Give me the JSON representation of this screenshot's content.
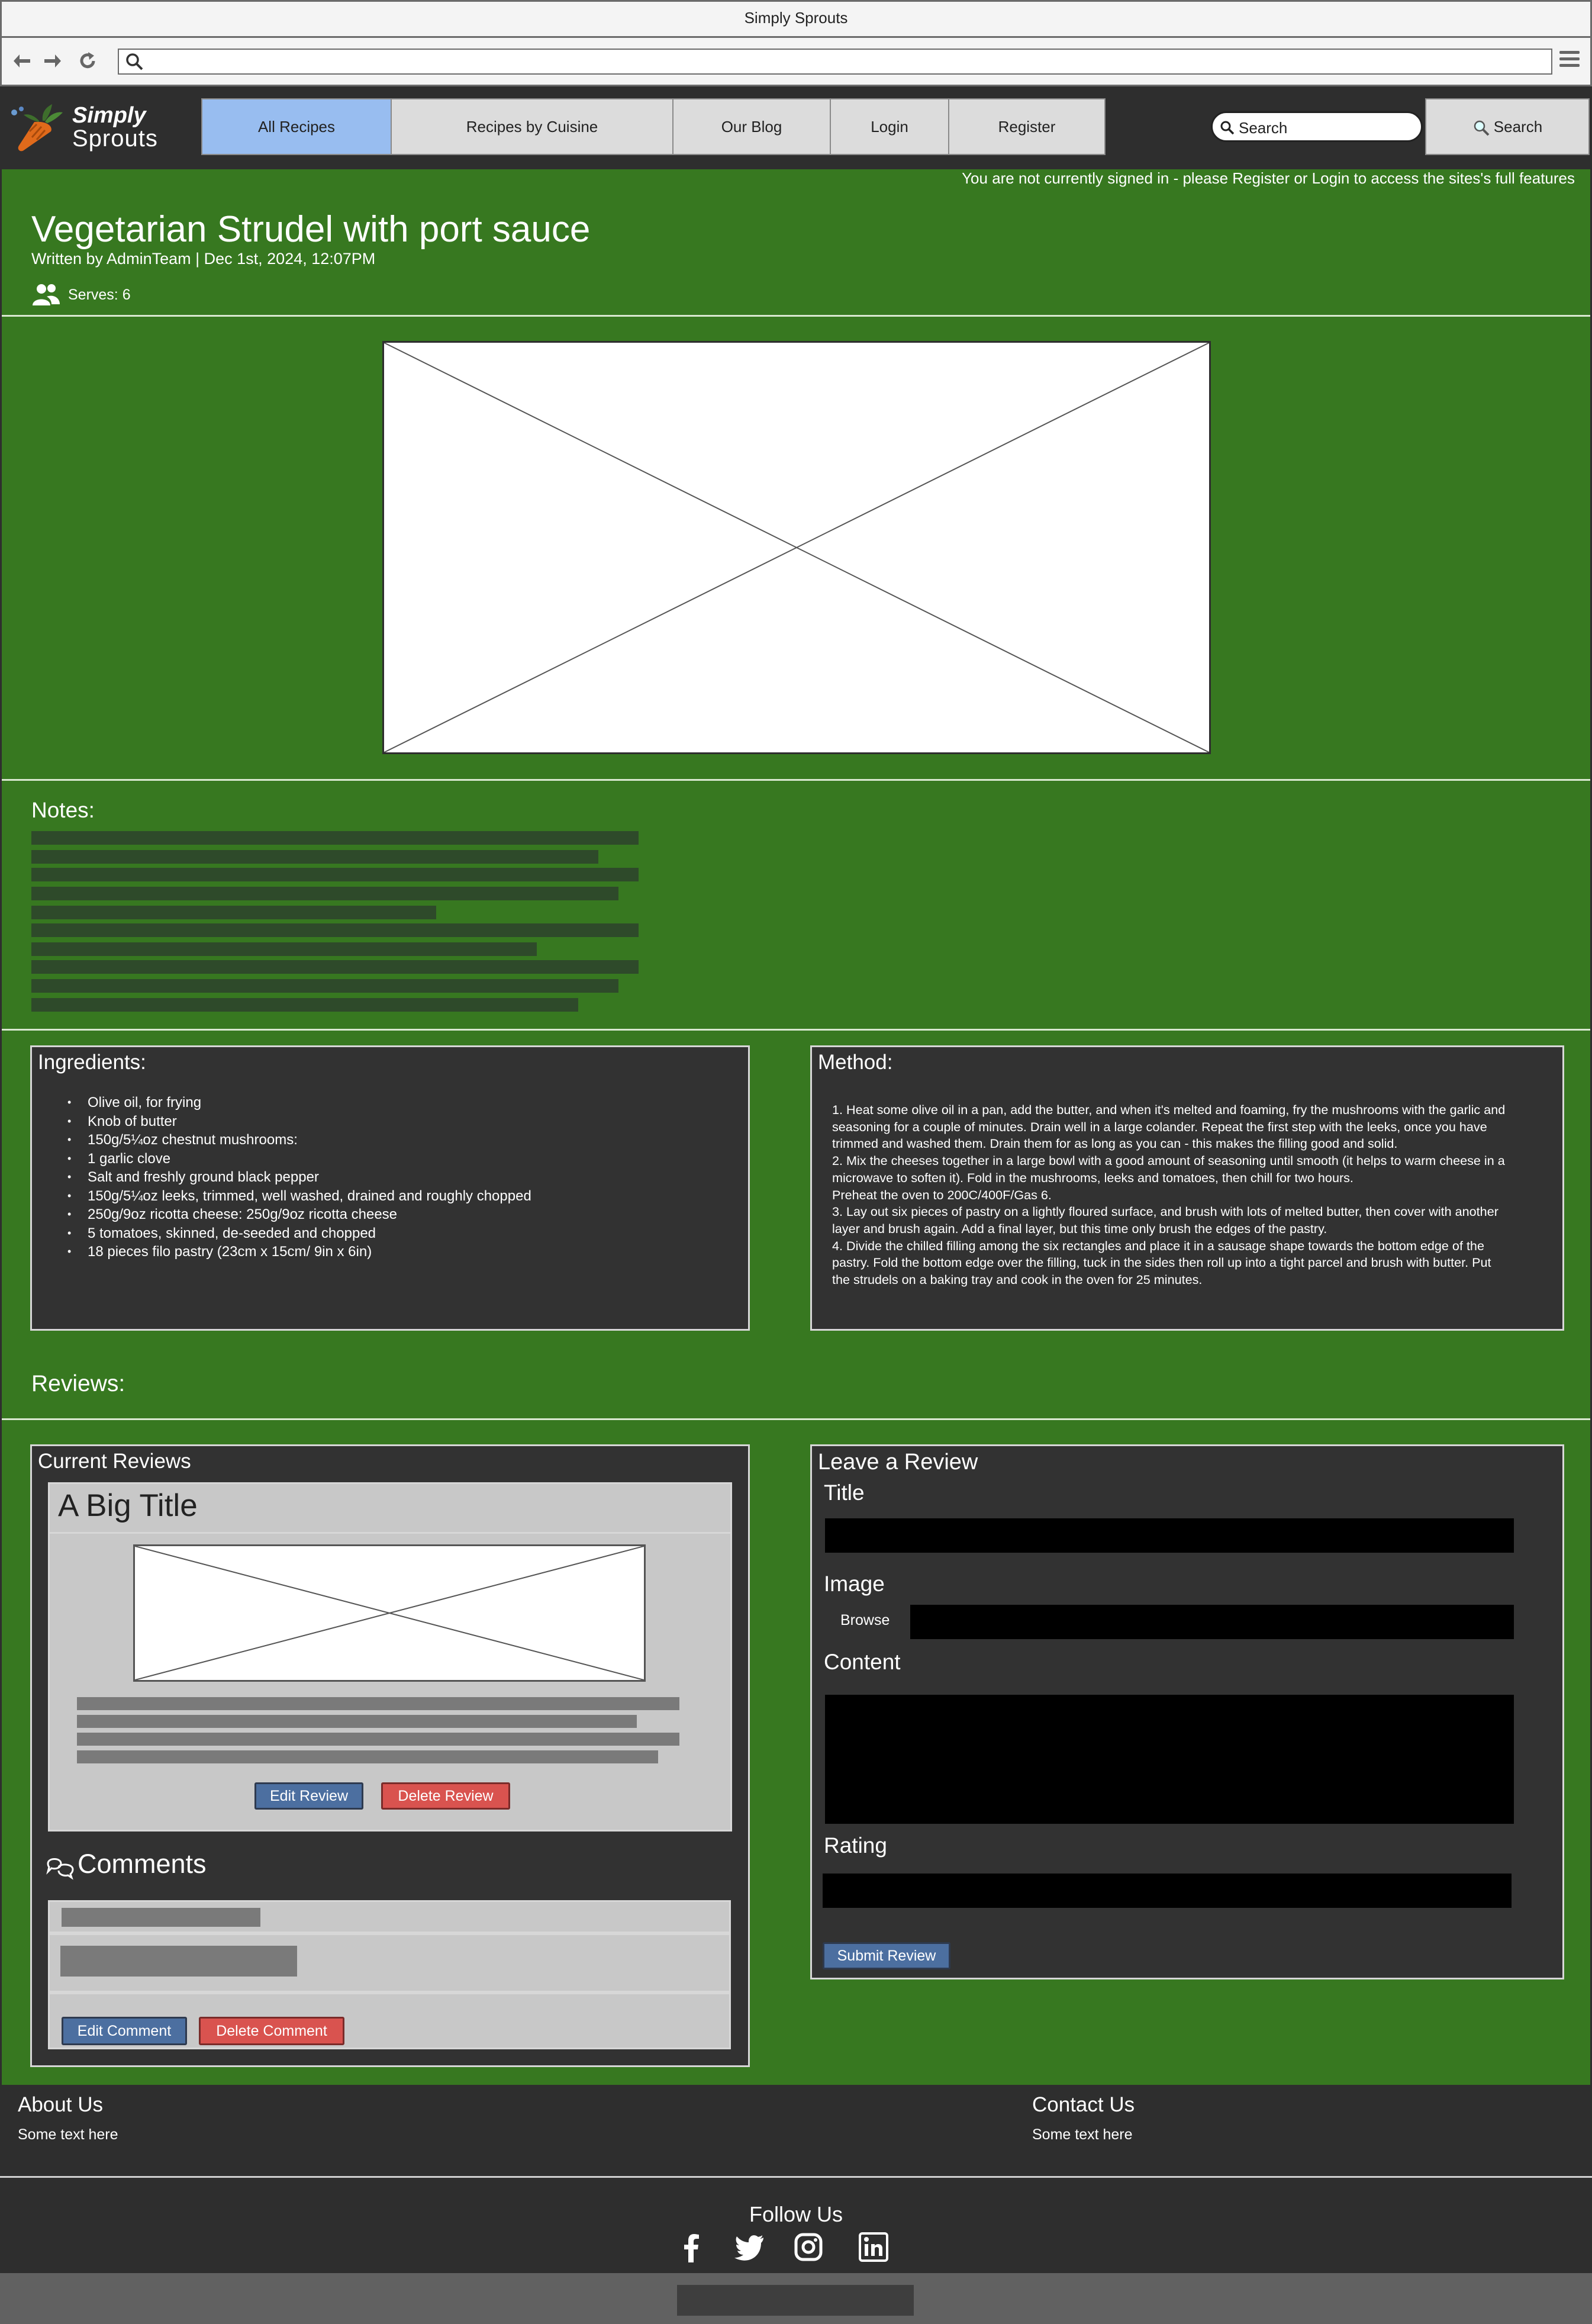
{
  "browser": {
    "window_title": "Simply Sprouts",
    "url": ""
  },
  "header": {
    "logo_line1": "Simply",
    "logo_line2": "Sprouts",
    "nav": [
      {
        "label": "All Recipes",
        "active": true
      },
      {
        "label": "Recipes by Cuisine",
        "active": false
      },
      {
        "label": "Our Blog",
        "active": false
      },
      {
        "label": "Login",
        "active": false
      },
      {
        "label": "Register",
        "active": false
      }
    ],
    "search_placeholder": "Search",
    "search_button": "Search"
  },
  "notice": "You are not currently signed in - please Register or Login to access the sites's full features",
  "recipe": {
    "title": "Vegetarian Strudel with port sauce",
    "meta": "Written by AdminTeam | Dec 1st, 2024, 12:07PM",
    "serves": "Serves: 6",
    "notes_heading": "Notes:",
    "ingredients_heading": "Ingredients:",
    "ingredients": [
      "Olive oil, for frying",
      "Knob of butter",
      "150g/5¼oz chestnut mushrooms:",
      "1 garlic clove",
      "Salt and freshly ground black pepper",
      "150g/5¼oz leeks, trimmed, well washed, drained and roughly chopped",
      "250g/9oz ricotta cheese: 250g/9oz ricotta cheese",
      "5 tomatoes, skinned, de-seeded and chopped",
      "18 pieces filo pastry (23cm x 15cm/ 9in x 6in)"
    ],
    "method_heading": "Method:",
    "method": [
      "1. Heat some olive oil in a pan, add the butter, and when it's melted and foaming, fry the mushrooms with the garlic and seasoning for a couple of minutes. Drain well in a large colander. Repeat the first step with the leeks, once you have trimmed and washed them. Drain them for as long as you can - this makes the filling good and solid.",
      "2. Mix the cheeses together in a large bowl with a good amount of seasoning until smooth (it helps to warm cheese in a microwave to soften it). Fold in the mushrooms, leeks and tomatoes, then chill for two hours.",
      "Preheat the oven to 200C/400F/Gas 6.",
      "3. Lay out six pieces of pastry on a lightly floured surface, and brush with lots of melted butter, then cover with another layer and brush again. Add a final layer, but this time only brush the edges of the pastry.",
      "4. Divide the chilled filling among the six rectangles and place it in a sausage shape towards the bottom edge of the pastry. Fold the bottom edge over the filling, tuck in the sides then roll up into a tight parcel and brush with butter. Put the strudels on a baking tray and cook in the oven for 25 minutes."
    ]
  },
  "reviews": {
    "heading": "Reviews:",
    "current_heading": "Current Reviews",
    "review": {
      "title": "A Big Title",
      "edit_button": "Edit Review",
      "delete_button": "Delete Review"
    },
    "comments_heading": "Comments",
    "edit_comment_button": "Edit Comment",
    "delete_comment_button": "Delete Comment",
    "form": {
      "heading": "Leave a Review",
      "title_label": "Title",
      "image_label": "Image",
      "browse_label": "Browse",
      "content_label": "Content",
      "rating_label": "Rating",
      "submit_button": "Submit Review"
    }
  },
  "footer": {
    "about_heading": "About Us",
    "about_text": "Some text here",
    "contact_heading": "Contact Us",
    "contact_text": "Some text here",
    "follow_heading": "Follow Us",
    "social_icons": [
      "facebook-icon",
      "twitter-icon",
      "instagram-icon",
      "linkedin-icon"
    ]
  },
  "colors": {
    "main_bg": "#377820",
    "panel_bg": "#323232",
    "active_tab": "#98bdf0",
    "button_blue": "#4c6fa0",
    "button_red": "#d9534f"
  }
}
